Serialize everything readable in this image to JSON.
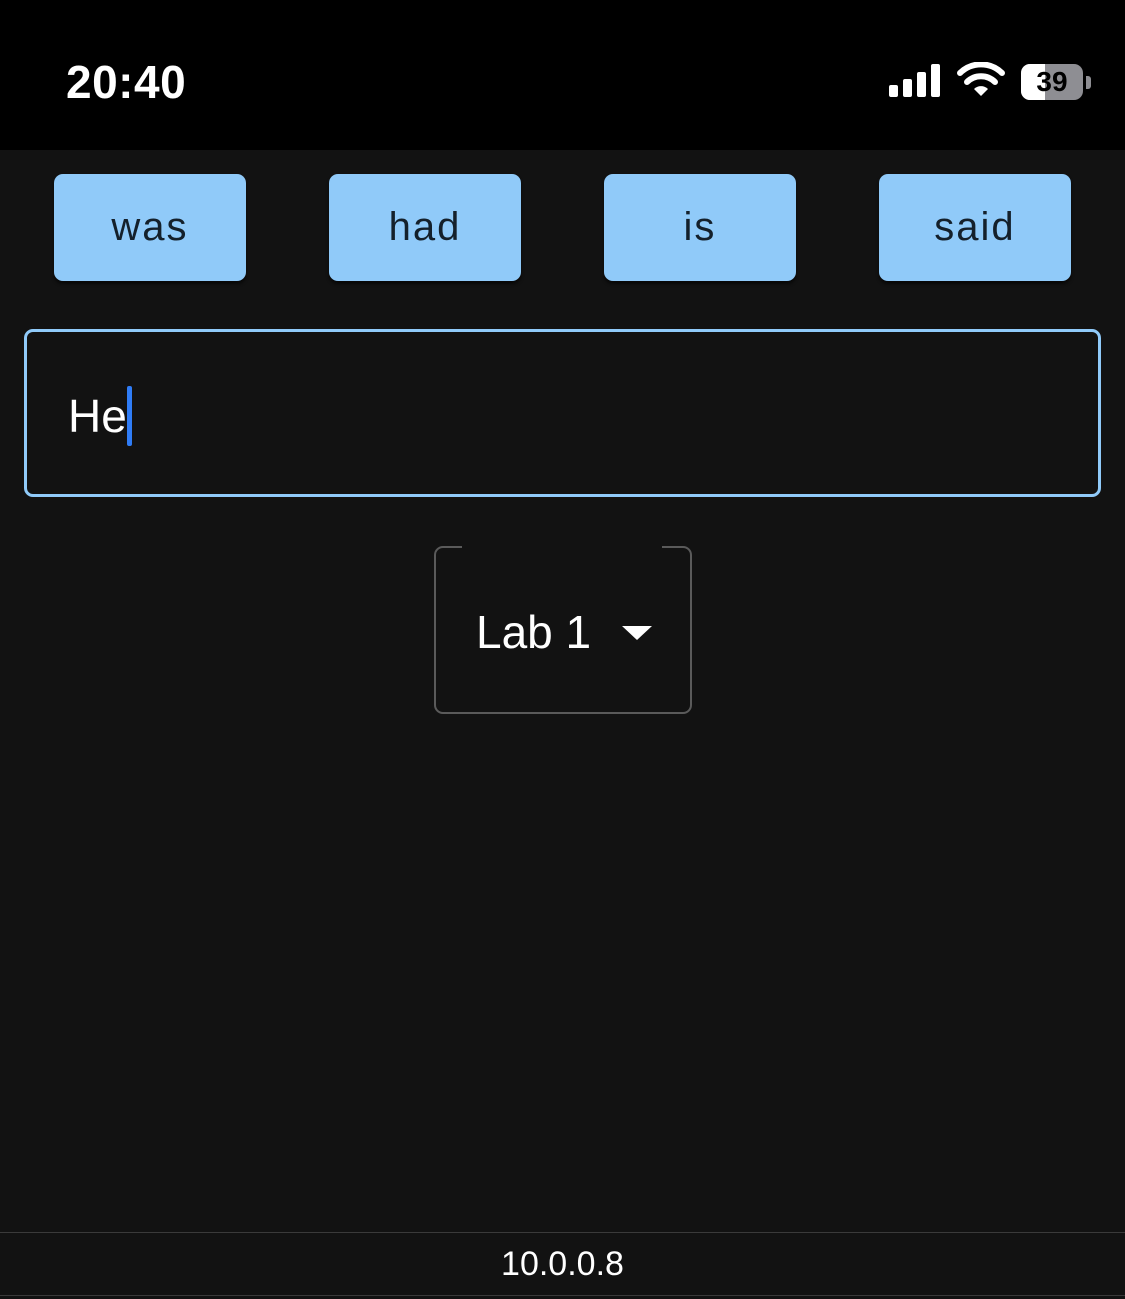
{
  "status_bar": {
    "time": "20:40",
    "signal_icon": "cellular-signal-icon",
    "wifi_icon": "wifi-icon",
    "battery": {
      "level": 39,
      "label": "39"
    }
  },
  "suggestions": [
    {
      "label": "was"
    },
    {
      "label": "had"
    },
    {
      "label": "is"
    },
    {
      "label": "said"
    }
  ],
  "text_input": {
    "value": "He"
  },
  "dropdown": {
    "selected": "Lab 1",
    "icon": "caret-down-icon"
  },
  "footer": {
    "address": "10.0.0.8"
  },
  "colors": {
    "background": "#121212",
    "status_bar": "#000000",
    "accent": "#90caf9",
    "caret": "#2f7cf6"
  }
}
